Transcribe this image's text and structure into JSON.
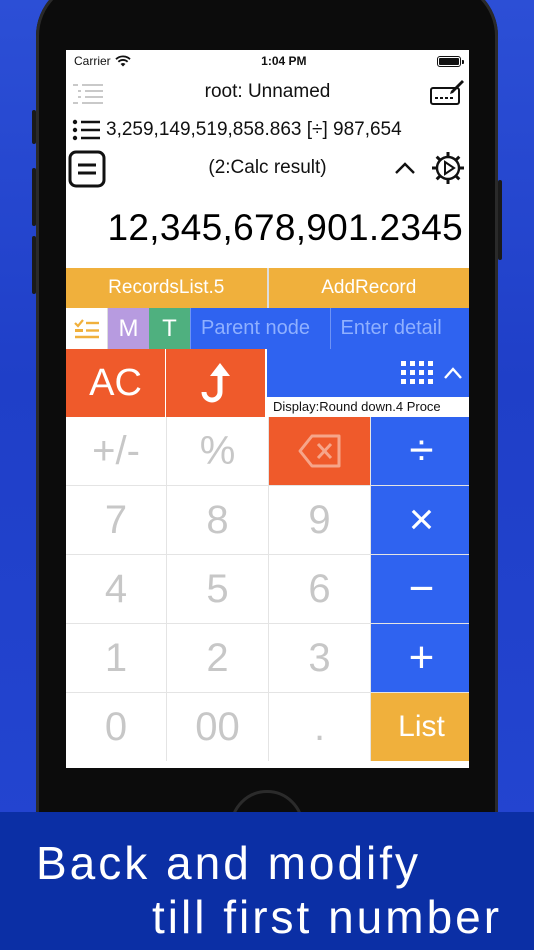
{
  "status_bar": {
    "carrier": "Carrier",
    "time": "1:04 PM"
  },
  "header": {
    "title": "root: Unnamed"
  },
  "expression": {
    "text": "3,259,149,519,858.863 [÷] 987,654"
  },
  "calc_row": {
    "label": "(2:Calc result)"
  },
  "display": {
    "value": "12,345,678,901.2345"
  },
  "records": {
    "list_label": "RecordsList.5",
    "add_label": "AddRecord"
  },
  "tags": {
    "m_label": "M",
    "t_label": "T",
    "parent_placeholder": "Parent node",
    "detail_placeholder": "Enter detail"
  },
  "ops": {
    "ac_label": "AC",
    "display_info": "Display:Round down.4 Proce"
  },
  "keypad": [
    {
      "name": "key-plus-minus",
      "label": "+/-",
      "type": "num"
    },
    {
      "name": "key-percent",
      "label": "%",
      "type": "num"
    },
    {
      "name": "key-backspace",
      "label": "",
      "type": "del"
    },
    {
      "name": "key-divide",
      "label": "÷",
      "type": "op"
    },
    {
      "name": "key-7",
      "label": "7",
      "type": "num"
    },
    {
      "name": "key-8",
      "label": "8",
      "type": "num"
    },
    {
      "name": "key-9",
      "label": "9",
      "type": "num"
    },
    {
      "name": "key-multiply",
      "label": "×",
      "type": "op"
    },
    {
      "name": "key-4",
      "label": "4",
      "type": "num"
    },
    {
      "name": "key-5",
      "label": "5",
      "type": "num"
    },
    {
      "name": "key-6",
      "label": "6",
      "type": "num"
    },
    {
      "name": "key-minus",
      "label": "−",
      "type": "op"
    },
    {
      "name": "key-1",
      "label": "1",
      "type": "num"
    },
    {
      "name": "key-2",
      "label": "2",
      "type": "num"
    },
    {
      "name": "key-3",
      "label": "3",
      "type": "num"
    },
    {
      "name": "key-plus",
      "label": "+",
      "type": "op"
    },
    {
      "name": "key-0",
      "label": "0",
      "type": "num"
    },
    {
      "name": "key-00",
      "label": "00",
      "type": "num"
    },
    {
      "name": "key-decimal",
      "label": ".",
      "type": "num"
    },
    {
      "name": "key-list",
      "label": "List",
      "type": "list"
    }
  ],
  "caption": {
    "line1": "Back and modify",
    "line2": "till first number"
  },
  "colors": {
    "blue": "#2f63f0",
    "orange": "#ef5a2b",
    "yellow": "#f0b03c",
    "purple": "#b79be0",
    "green": "#4fb07f",
    "caption_bg": "#0b2fa5"
  },
  "icons": [
    "wifi-icon",
    "battery-icon",
    "outline-list-icon",
    "keyboard-edit-icon",
    "list-icon",
    "memo-icon",
    "chevron-up-icon",
    "gear-icon",
    "checklist-icon",
    "undo-arrow-icon",
    "keypad-grid-icon",
    "backspace-icon"
  ]
}
